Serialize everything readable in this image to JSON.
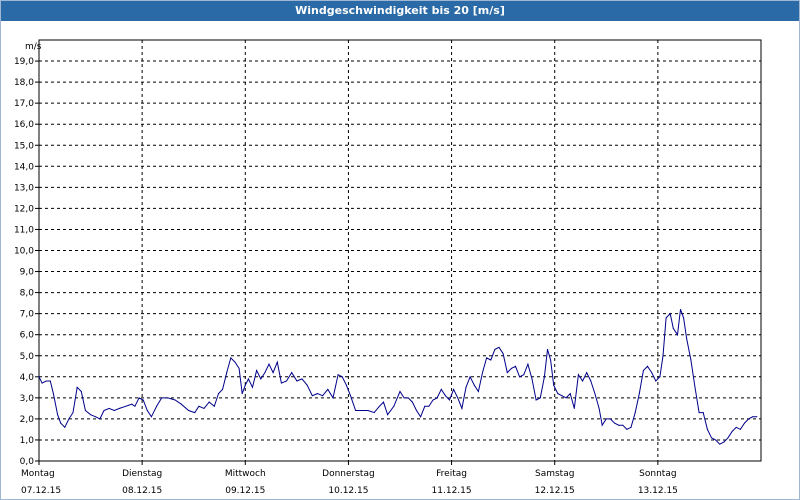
{
  "window": {
    "title": "Windgeschwindigkeit bis 20 [m/s]"
  },
  "colors": {
    "titlebar": "#2a6aa6",
    "line": "#00008b",
    "grid": "#000000"
  },
  "chart_data": {
    "type": "line",
    "title": "Windgeschwindigkeit bis 20 [m/s]",
    "ylabel": "m/s",
    "xlabel": "",
    "ylim": [
      0,
      20
    ],
    "yticks": [
      "0,0",
      "1,0",
      "2,0",
      "3,0",
      "4,0",
      "5,0",
      "6,0",
      "7,0",
      "8,0",
      "9,0",
      "10,0",
      "11,0",
      "12,0",
      "13,0",
      "14,0",
      "15,0",
      "16,0",
      "17,0",
      "18,0",
      "19,0"
    ],
    "xlim": [
      0,
      7
    ],
    "x_ticks": [
      {
        "day": "Montag",
        "date": "07.12.15"
      },
      {
        "day": "Dienstag",
        "date": "08.12.15"
      },
      {
        "day": "Mittwoch",
        "date": "09.12.15"
      },
      {
        "day": "Donnerstag",
        "date": "10.12.15"
      },
      {
        "day": "Freitag",
        "date": "11.12.15"
      },
      {
        "day": "Samstag",
        "date": "12.12.15"
      },
      {
        "day": "Sonntag",
        "date": "13.12.15"
      }
    ],
    "grid": true,
    "series": [
      {
        "values": [
          [
            0.0,
            4.0
          ],
          [
            0.03,
            3.7
          ],
          [
            0.07,
            3.8
          ],
          [
            0.11,
            3.8
          ],
          [
            0.14,
            3.2
          ],
          [
            0.18,
            2.2
          ],
          [
            0.21,
            1.8
          ],
          [
            0.25,
            1.6
          ],
          [
            0.29,
            2.0
          ],
          [
            0.33,
            2.3
          ],
          [
            0.37,
            3.5
          ],
          [
            0.41,
            3.3
          ],
          [
            0.45,
            2.4
          ],
          [
            0.5,
            2.2
          ],
          [
            0.55,
            2.1
          ],
          [
            0.59,
            2.0
          ],
          [
            0.63,
            2.4
          ],
          [
            0.68,
            2.5
          ],
          [
            0.73,
            2.4
          ],
          [
            0.78,
            2.5
          ],
          [
            0.84,
            2.6
          ],
          [
            0.9,
            2.7
          ],
          [
            0.93,
            2.6
          ],
          [
            0.97,
            3.0
          ],
          [
            1.01,
            2.9
          ],
          [
            1.05,
            2.4
          ],
          [
            1.09,
            2.1
          ],
          [
            1.14,
            2.6
          ],
          [
            1.19,
            3.0
          ],
          [
            1.25,
            3.0
          ],
          [
            1.32,
            2.9
          ],
          [
            1.38,
            2.7
          ],
          [
            1.45,
            2.4
          ],
          [
            1.51,
            2.3
          ],
          [
            1.55,
            2.6
          ],
          [
            1.6,
            2.5
          ],
          [
            1.65,
            2.8
          ],
          [
            1.7,
            2.6
          ],
          [
            1.74,
            3.2
          ],
          [
            1.78,
            3.4
          ],
          [
            1.82,
            4.2
          ],
          [
            1.86,
            4.9
          ],
          [
            1.9,
            4.7
          ],
          [
            1.94,
            4.4
          ],
          [
            1.97,
            3.2
          ],
          [
            2.0,
            3.6
          ],
          [
            2.03,
            3.9
          ],
          [
            2.07,
            3.5
          ],
          [
            2.11,
            4.3
          ],
          [
            2.15,
            3.9
          ],
          [
            2.19,
            4.2
          ],
          [
            2.23,
            4.6
          ],
          [
            2.27,
            4.2
          ],
          [
            2.31,
            4.7
          ],
          [
            2.35,
            3.7
          ],
          [
            2.4,
            3.8
          ],
          [
            2.45,
            4.2
          ],
          [
            2.5,
            3.8
          ],
          [
            2.55,
            3.9
          ],
          [
            2.6,
            3.6
          ],
          [
            2.65,
            3.1
          ],
          [
            2.7,
            3.2
          ],
          [
            2.75,
            3.1
          ],
          [
            2.8,
            3.4
          ],
          [
            2.85,
            3.0
          ],
          [
            2.9,
            4.1
          ],
          [
            2.94,
            4.0
          ],
          [
            2.98,
            3.6
          ],
          [
            3.02,
            3.1
          ],
          [
            3.07,
            2.4
          ],
          [
            3.13,
            2.4
          ],
          [
            3.19,
            2.4
          ],
          [
            3.25,
            2.3
          ],
          [
            3.3,
            2.6
          ],
          [
            3.34,
            2.8
          ],
          [
            3.38,
            2.2
          ],
          [
            3.44,
            2.6
          ],
          [
            3.5,
            3.3
          ],
          [
            3.54,
            3.0
          ],
          [
            3.58,
            3.0
          ],
          [
            3.62,
            2.8
          ],
          [
            3.66,
            2.4
          ],
          [
            3.7,
            2.1
          ],
          [
            3.74,
            2.6
          ],
          [
            3.78,
            2.6
          ],
          [
            3.82,
            2.9
          ],
          [
            3.86,
            3.0
          ],
          [
            3.9,
            3.4
          ],
          [
            3.94,
            3.1
          ],
          [
            3.98,
            2.9
          ],
          [
            4.02,
            3.4
          ],
          [
            4.06,
            3.0
          ],
          [
            4.1,
            2.5
          ],
          [
            4.14,
            3.5
          ],
          [
            4.18,
            4.0
          ],
          [
            4.22,
            3.6
          ],
          [
            4.26,
            3.3
          ],
          [
            4.3,
            4.2
          ],
          [
            4.34,
            4.9
          ],
          [
            4.38,
            4.8
          ],
          [
            4.42,
            5.3
          ],
          [
            4.46,
            5.4
          ],
          [
            4.5,
            5.1
          ],
          [
            4.54,
            4.2
          ],
          [
            4.58,
            4.4
          ],
          [
            4.62,
            4.5
          ],
          [
            4.66,
            4.0
          ],
          [
            4.7,
            4.1
          ],
          [
            4.74,
            4.6
          ],
          [
            4.78,
            3.9
          ],
          [
            4.82,
            2.9
          ],
          [
            4.86,
            3.0
          ],
          [
            4.9,
            4.0
          ],
          [
            4.93,
            5.3
          ],
          [
            4.96,
            4.8
          ],
          [
            4.99,
            3.6
          ],
          [
            5.03,
            3.2
          ],
          [
            5.07,
            3.1
          ],
          [
            5.11,
            3.0
          ],
          [
            5.15,
            3.2
          ],
          [
            5.19,
            2.5
          ],
          [
            5.23,
            4.1
          ],
          [
            5.27,
            3.8
          ],
          [
            5.31,
            4.2
          ],
          [
            5.35,
            3.8
          ],
          [
            5.39,
            3.2
          ],
          [
            5.43,
            2.5
          ],
          [
            5.46,
            1.7
          ],
          [
            5.5,
            2.0
          ],
          [
            5.54,
            2.0
          ],
          [
            5.58,
            1.8
          ],
          [
            5.62,
            1.7
          ],
          [
            5.66,
            1.7
          ],
          [
            5.7,
            1.5
          ],
          [
            5.74,
            1.6
          ],
          [
            5.78,
            2.3
          ],
          [
            5.82,
            3.2
          ],
          [
            5.86,
            4.3
          ],
          [
            5.9,
            4.5
          ],
          [
            5.94,
            4.2
          ],
          [
            5.98,
            3.8
          ],
          [
            6.02,
            4.0
          ],
          [
            6.05,
            5.0
          ],
          [
            6.08,
            6.8
          ],
          [
            6.12,
            7.0
          ],
          [
            6.15,
            6.3
          ],
          [
            6.19,
            6.0
          ],
          [
            6.22,
            7.2
          ],
          [
            6.25,
            6.8
          ],
          [
            6.28,
            5.8
          ],
          [
            6.32,
            4.8
          ],
          [
            6.36,
            3.5
          ],
          [
            6.4,
            2.3
          ],
          [
            6.44,
            2.3
          ],
          [
            6.48,
            1.5
          ],
          [
            6.52,
            1.1
          ],
          [
            6.56,
            1.0
          ],
          [
            6.6,
            0.8
          ],
          [
            6.64,
            0.9
          ],
          [
            6.68,
            1.1
          ],
          [
            6.72,
            1.4
          ],
          [
            6.76,
            1.6
          ],
          [
            6.8,
            1.5
          ],
          [
            6.84,
            1.8
          ],
          [
            6.88,
            2.0
          ],
          [
            6.92,
            2.1
          ],
          [
            6.96,
            2.1
          ]
        ]
      }
    ]
  }
}
